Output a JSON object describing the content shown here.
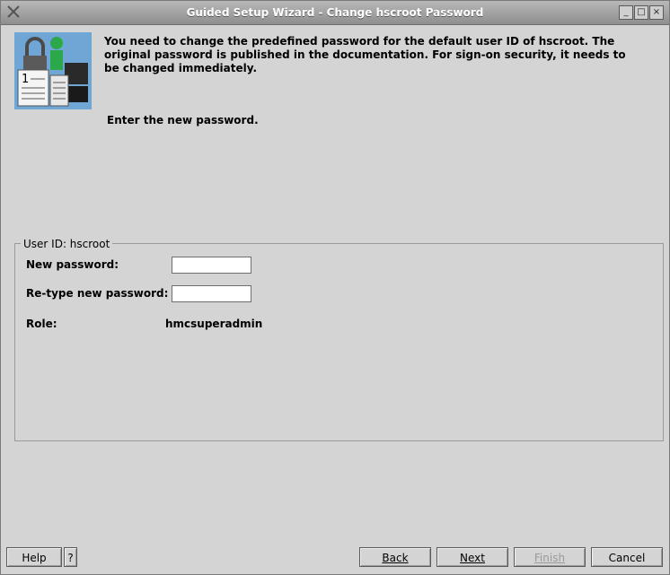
{
  "window": {
    "title": "Guided Setup Wizard - Change hscroot Password",
    "controls": {
      "minimize": "_",
      "maximize": "□",
      "close": "×"
    }
  },
  "intro": {
    "text": "You need to change the predefined password for the default user ID of hscroot. The original password is published in the documentation.  For sign-on security, it needs to be changed immediately."
  },
  "prompt": "Enter the new password.",
  "group": {
    "legend": "User ID:  hscroot",
    "new_password": {
      "label": "New password:",
      "value": ""
    },
    "retype_password": {
      "label": "Re-type new password:",
      "value": ""
    },
    "role": {
      "label": "Role:",
      "value": "hmcsuperadmin"
    }
  },
  "buttons": {
    "help": "Help",
    "help_q": "?",
    "back": "Back",
    "next": "Next",
    "finish": "Finish",
    "cancel": "Cancel"
  },
  "icons": {
    "system": "x-logo-icon",
    "logo": "security-lock-document-icon"
  }
}
